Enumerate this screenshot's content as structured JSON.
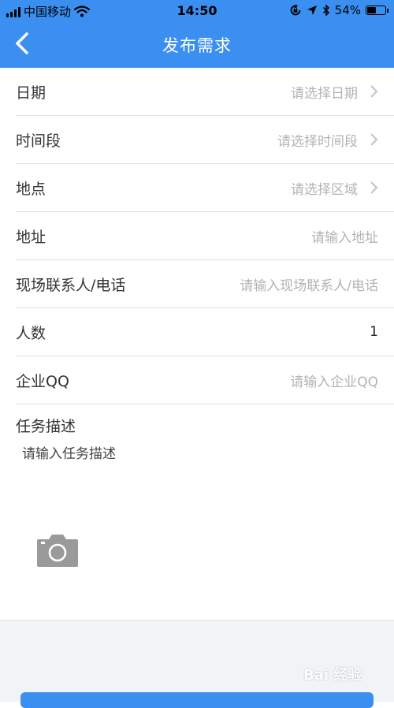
{
  "status_bar": {
    "carrier": "中国移动",
    "time": "14:50",
    "battery_percent": "54%",
    "battery_level": 0.54,
    "icons": [
      "signal-icon",
      "wifi-icon",
      "lock-rotation-icon",
      "location-icon",
      "bluetooth-icon",
      "battery-icon"
    ]
  },
  "navbar": {
    "title": "发布需求",
    "back_icon": "chevron-left-icon"
  },
  "form": {
    "rows": [
      {
        "label": "日期",
        "value": "请选择日期",
        "is_placeholder": true,
        "has_arrow": true
      },
      {
        "label": "时间段",
        "value": "请选择时间段",
        "is_placeholder": true,
        "has_arrow": true
      },
      {
        "label": "地点",
        "value": "请选择区域",
        "is_placeholder": true,
        "has_arrow": true
      },
      {
        "label": "地址",
        "value": "请输入地址",
        "is_placeholder": true,
        "has_arrow": false
      },
      {
        "label": "现场联系人/电话",
        "value": "请输入现场联系人/电话",
        "is_placeholder": true,
        "has_arrow": false
      },
      {
        "label": "人数",
        "value": "1",
        "is_placeholder": false,
        "has_arrow": false
      },
      {
        "label": "企业QQ",
        "value": "请输入企业QQ",
        "is_placeholder": true,
        "has_arrow": false
      }
    ],
    "description": {
      "label": "任务描述",
      "placeholder": "请输入任务描述"
    },
    "camera_icon": "camera-icon"
  },
  "watermark": "Bai 经验",
  "colors": {
    "header_bg": "#3b8ff0",
    "placeholder": "#b3b3b3",
    "label": "#333333",
    "divider": "#e1e1e1",
    "bottom_bg": "#f1f4f6"
  }
}
